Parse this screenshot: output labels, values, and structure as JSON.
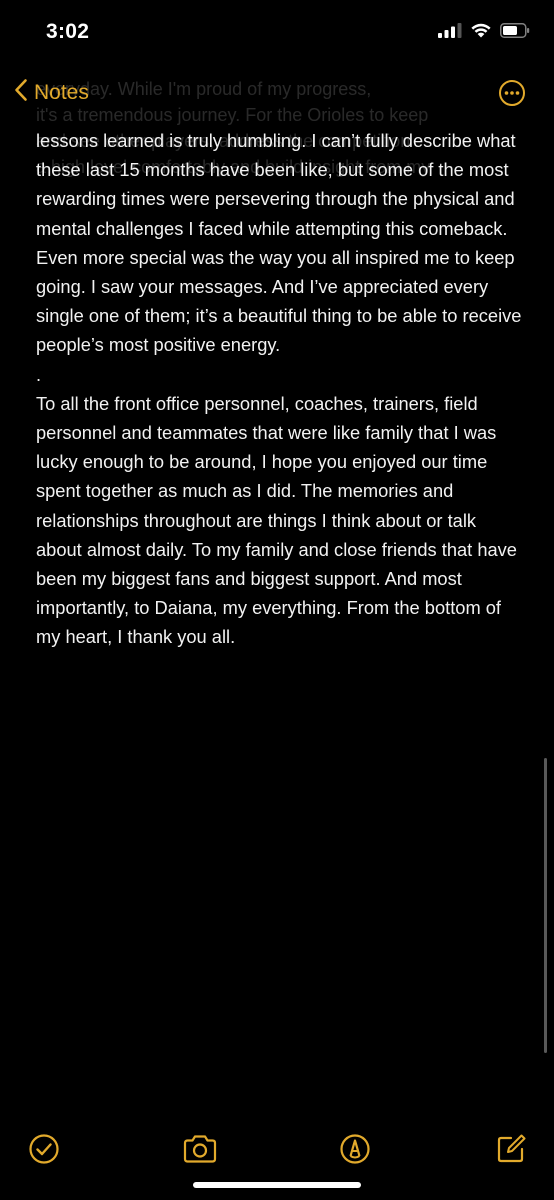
{
  "status": {
    "time": "3:02"
  },
  "nav": {
    "back_label": "Notes"
  },
  "note": {
    "ghost_lines": [
      "everyday. While I'm proud of my progress,",
      "it's a tremendous journey. For the Orioles to keep",
      "and see other players, address the competition",
      "a high level comfortably and build insight from my"
    ],
    "paragraph_1": "lessons learned is truly humbling. I can’t fully describe what these last 15 months have been like, but some of the most rewarding times were persevering through the physical and mental challenges I faced while attempting this comeback. Even more special was the way you all inspired me to keep going. I saw your messages. And I’ve appreciated every single one of them; it’s a beautiful thing to be able to receive people’s most positive energy.",
    "separator": ".",
    "paragraph_2": "To all the front office personnel, coaches, trainers, field personnel and teammates that were like family that I was lucky enough to be around, I hope you enjoyed our time spent together as much as I did. The memories and relationships throughout are things I think about or talk about almost daily. To my family and close friends that have been my biggest fans and biggest support. And most importantly, to Daiana, my everything. From the bottom of my heart, I thank you all."
  },
  "toolbar": {
    "icons": [
      "checklist-icon",
      "camera-icon",
      "markup-icon",
      "compose-icon"
    ]
  },
  "colors": {
    "accent": "#e2aa2c",
    "background": "#000000",
    "text": "#f2f2f2"
  }
}
